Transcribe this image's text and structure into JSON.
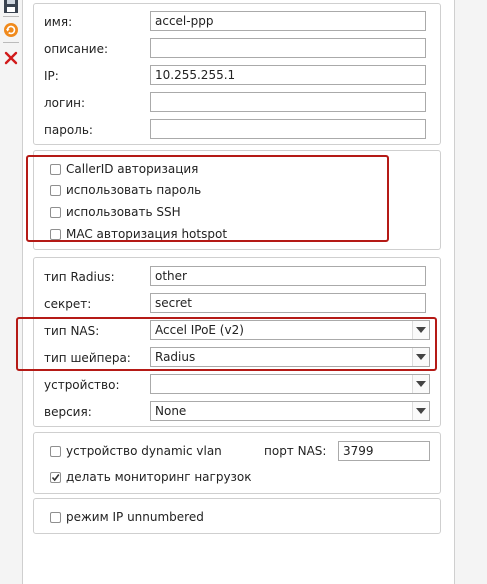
{
  "toolbar": {
    "icons": [
      "save-icon",
      "refresh-icon",
      "delete-icon"
    ]
  },
  "basic": {
    "name_label": "имя:",
    "name_value": "accel-ppp",
    "desc_label": "описание:",
    "desc_value": "",
    "ip_label": "IP:",
    "ip_value": "10.255.255.1",
    "login_label": "логин:",
    "login_value": "",
    "password_label": "пароль:",
    "password_value": ""
  },
  "auth": {
    "callerid": {
      "label": "CallerID авторизация",
      "checked": false
    },
    "use_password": {
      "label": "использовать пароль",
      "checked": false
    },
    "use_ssh": {
      "label": "использовать SSH",
      "checked": false
    },
    "mac_hotspot": {
      "label": "MAC авторизация hotspot",
      "checked": false
    }
  },
  "radius": {
    "type_label": "тип Radius:",
    "type_value": "other",
    "secret_label": "секрет:",
    "secret_value": "secret",
    "nas_type_label": "тип NAS:",
    "nas_type_value": "Accel IPoE (v2)",
    "shaper_label": "тип шейпера:",
    "shaper_value": "Radius",
    "device_label": "устройство:",
    "device_value": "",
    "version_label": "версия:",
    "version_value": "None"
  },
  "extra": {
    "dynamic_vlan": {
      "label": "устройство dynamic vlan",
      "checked": false
    },
    "nas_port_label": "порт NAS:",
    "nas_port_value": "3799",
    "monitoring": {
      "label": "делать мониторинг нагрузок",
      "checked": true
    }
  },
  "unnumbered": {
    "label": "режим IP unnumbered",
    "checked": false
  },
  "colors": {
    "highlight": "#b51a16",
    "border": "#cfcfcf"
  }
}
